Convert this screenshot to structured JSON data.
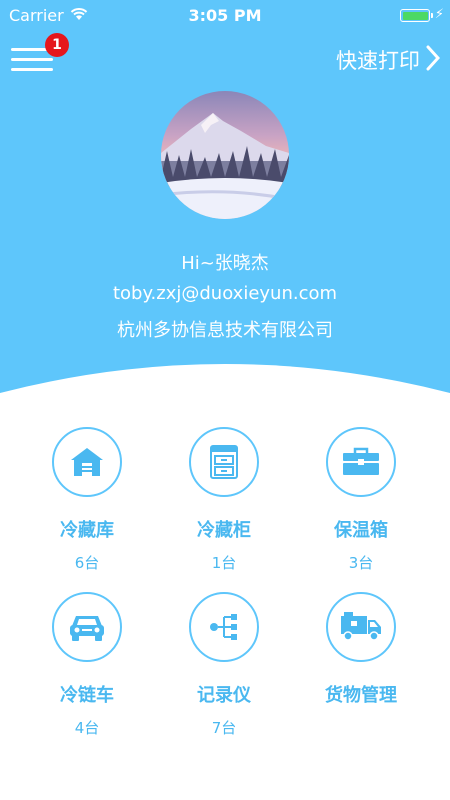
{
  "status_bar": {
    "carrier": "Carrier",
    "time": "3:05 PM"
  },
  "header": {
    "menu_badge_count": "1",
    "quick_print_label": "快速打印",
    "chevron": "❯"
  },
  "profile": {
    "greeting": "Hi~张晓杰",
    "email": "toby.zxj@duoxieyun.com",
    "company": "杭州多协信息技术有限公司"
  },
  "colors": {
    "header_bg": "#5ec6fb",
    "accent": "#4ab8f0",
    "badge": "#e5161c",
    "battery": "#4cd964"
  },
  "devices": [
    {
      "name": "冷藏库",
      "count": "6台",
      "icon": "warehouse-icon"
    },
    {
      "name": "冷藏柜",
      "count": "1台",
      "icon": "cabinet-icon"
    },
    {
      "name": "保温箱",
      "count": "3台",
      "icon": "insulated-box-icon"
    },
    {
      "name": "冷链车",
      "count": "4台",
      "icon": "car-icon"
    },
    {
      "name": "记录仪",
      "count": "7台",
      "icon": "recorder-icon"
    },
    {
      "name": "货物管理",
      "count": "",
      "icon": "truck-icon"
    }
  ]
}
